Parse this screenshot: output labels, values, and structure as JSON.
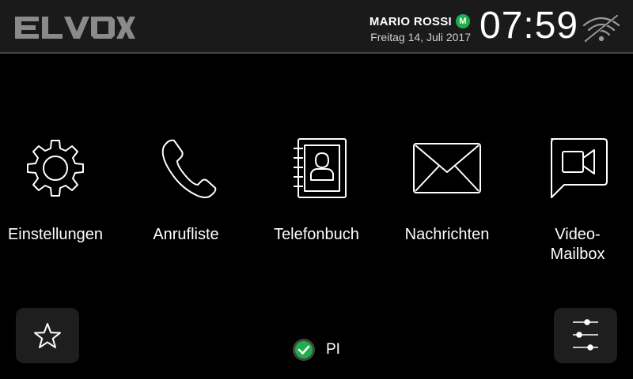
{
  "header": {
    "brand_logo_text": "ELVOX",
    "user_name": "MARIO ROSSI",
    "user_badge": "M",
    "date": "Freitag 14, Juli 2017",
    "time": "07:59",
    "wifi_icon": "wifi-off-icon"
  },
  "apps": [
    {
      "label": "Einstellungen",
      "icon": "gear-icon"
    },
    {
      "label": "Anrufliste",
      "icon": "phone-icon"
    },
    {
      "label": "Telefonbuch",
      "icon": "address-book-icon"
    },
    {
      "label": "Nachrichten",
      "icon": "envelope-icon"
    },
    {
      "label_line1": "Video-",
      "label_line2": "Mailbox",
      "icon": "video-message-icon"
    }
  ],
  "footer": {
    "favorites_icon": "star-icon",
    "settings_icon": "sliders-icon",
    "status_label": "PI",
    "status_icon": "check-circle-icon"
  },
  "colors": {
    "background": "#000000",
    "topbar": "#1a1a1a",
    "badge_green": "#1fae4b",
    "button_bg": "#1e1e1e"
  }
}
